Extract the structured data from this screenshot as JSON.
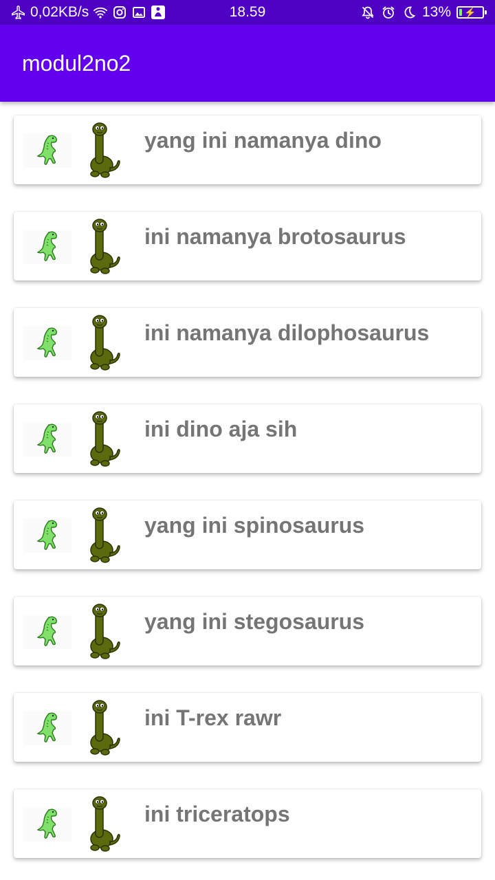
{
  "status_bar": {
    "net_speed": "0,02KB/s",
    "time": "18.59",
    "battery_percent": "13%",
    "battery_level": 0.13,
    "icons": [
      "airplane-icon",
      "wifi-icon",
      "instagram-icon",
      "gallery-icon",
      "app-notification-icon",
      "mute-icon",
      "alarm-icon",
      "moon-icon",
      "battery-icon"
    ]
  },
  "app_bar": {
    "title": "modul2no2",
    "color": "#6200ee"
  },
  "list": {
    "items": [
      {
        "label": "yang ini namanya dino"
      },
      {
        "label": "ini namanya brotosaurus"
      },
      {
        "label": "ini namanya dilophosaurus"
      },
      {
        "label": "ini dino aja sih"
      },
      {
        "label": "yang ini spinosaurus"
      },
      {
        "label": "yang ini stegosaurus"
      },
      {
        "label": "ini T-rex rawr"
      },
      {
        "label": "ini triceratops"
      }
    ]
  }
}
